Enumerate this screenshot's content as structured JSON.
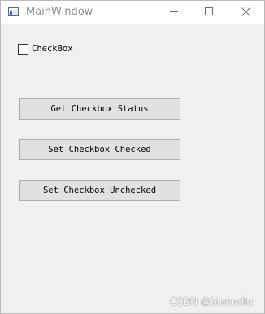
{
  "window": {
    "title": "MainWindow",
    "controls": [
      "minimize-icon",
      "maximize-icon",
      "close-icon"
    ]
  },
  "checkbox": {
    "label": "CheckBox",
    "checked": false
  },
  "buttons": {
    "get_status": "Get Checkbox Status",
    "set_checked": "Set Checkbox Checked",
    "set_unchecked": "Set Checkbox Unchecked"
  },
  "watermark": "CSDN @bluemliu",
  "colors": {
    "window_bg": "#f0f0f0",
    "titlebar_bg": "#ffffff",
    "button_bg": "#e1e1e1",
    "button_border": "#adadad"
  }
}
